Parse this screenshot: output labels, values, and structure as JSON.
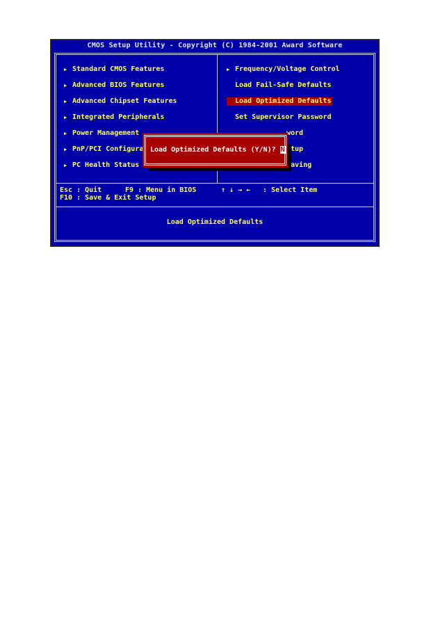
{
  "bios": {
    "title": "CMOS Setup Utility - Copyright (C) 1984-2001 Award Software",
    "left_menu": [
      {
        "label": "Standard CMOS Features",
        "submenu": true
      },
      {
        "label": "Advanced BIOS Features",
        "submenu": true
      },
      {
        "label": "Advanced Chipset Features",
        "submenu": true
      },
      {
        "label": "Integrated Peripherals",
        "submenu": true
      },
      {
        "label": "Power Management",
        "submenu": true
      },
      {
        "label": "PnP/PCI Configura",
        "submenu": true
      },
      {
        "label": "PC Health Status",
        "submenu": true
      }
    ],
    "right_menu": [
      {
        "label": "Frequency/Voltage Control",
        "submenu": true
      },
      {
        "label": "Load Fail-Safe Defaults",
        "submenu": false
      },
      {
        "label": "Load Optimized Defaults",
        "submenu": false,
        "selected": true
      },
      {
        "label": "Set Supervisor Password",
        "submenu": false
      },
      {
        "label": "word",
        "submenu": false
      },
      {
        "label": "etup",
        "submenu": false
      },
      {
        "label": "Saving",
        "submenu": false
      }
    ],
    "help": {
      "esc": "Esc : Quit",
      "f9": "F9 : Menu in BIOS",
      "arrows": "↑ ↓ → ←",
      "select": ": Select Item",
      "f10": "F10 : Save & Exit Setup"
    },
    "status_line": "Load Optimized Defaults",
    "dialog": {
      "prompt": "Load Optimized Defaults (Y/N)? ",
      "value": "N"
    },
    "arrow_glyph": "▶"
  },
  "colors": {
    "background": "#0000a8",
    "text": "#ffff54",
    "highlight": "#a80000",
    "dialog_text": "#ffffff"
  }
}
